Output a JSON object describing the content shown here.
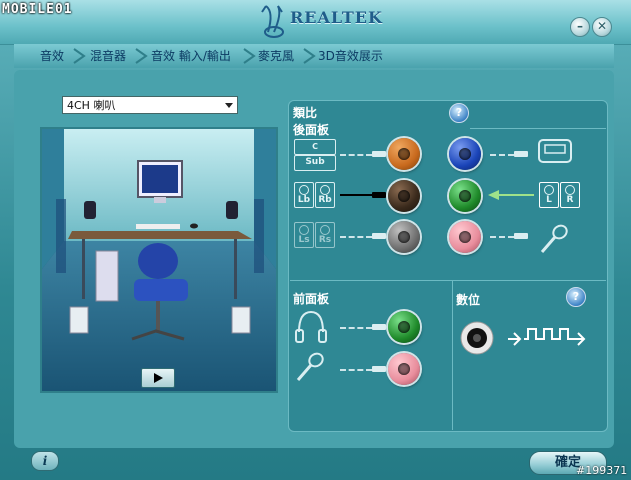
{
  "watermark": "MOBILE01",
  "window": {
    "brand": "REALTEK"
  },
  "tabs": [
    {
      "label": "音效"
    },
    {
      "label": "混音器"
    },
    {
      "label": "音效 輸入/輸出"
    },
    {
      "label": "麥克風"
    },
    {
      "label": "3D音效展示"
    }
  ],
  "device_select": {
    "value": "4CH 喇叭"
  },
  "analog": {
    "title": "類比",
    "rear_title": "後面板",
    "front_title": "前面板",
    "speaker_labels": {
      "center": "C",
      "sub": "Sub",
      "lb": "Lb",
      "rb": "Rb",
      "ls": "Ls",
      "rs": "Rs",
      "l": "L",
      "r": "R"
    }
  },
  "digital": {
    "title": "數位"
  },
  "jack_colors": {
    "orange": "#c86a1e",
    "black": "#3a2a1c",
    "gray": "#6e6e6e",
    "blue": "#1a44b8",
    "green": "#1f8a2a",
    "pink": "#e88d9c"
  },
  "footer": {
    "ok_label": "確定",
    "image_id": "#199371"
  }
}
